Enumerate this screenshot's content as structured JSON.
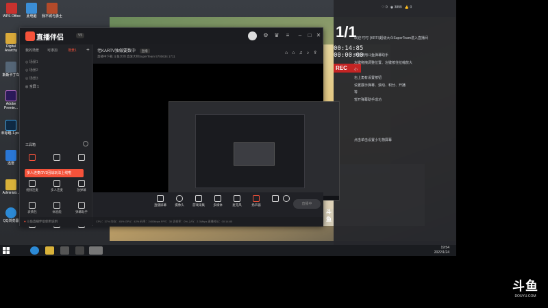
{
  "desktop": {
    "icons": [
      {
        "label": "WPS Office",
        "color": "#c8322e",
        "name": "wps-office-icon"
      },
      {
        "label": "此电脑",
        "color": "#3b8ed6",
        "name": "computer-icon"
      },
      {
        "label": "我不城与勇士",
        "color": "#b34a2a",
        "name": "game-icon"
      },
      {
        "label": "Digital Anarchy",
        "color": "#d9a93a",
        "name": "digital-anarchy-icon"
      },
      {
        "label": "斯斯卡丁车",
        "color": "#556677",
        "name": "kart-icon"
      },
      {
        "label": "Adobe Premie...",
        "color": "#2b1a5a",
        "name": "premiere-icon"
      },
      {
        "label": "未标题-1.psd",
        "color": "#0f2a44",
        "name": "psd-icon"
      },
      {
        "label": "迅雷",
        "color": "#2a77d6",
        "name": "xunlei-icon"
      },
      {
        "label": "Administr...",
        "color": "#d9b23a",
        "name": "folder-icon"
      },
      {
        "label": "QQ浏览器",
        "color": "#2c8ad6",
        "name": "qq-browser-icon"
      }
    ]
  },
  "chat": {
    "big_count": "1/1",
    "timestamp": "00:14:85\n00:00:00",
    "rec_label": "REC",
    "welcome": "欢迎 叮叮 {KRTI}超级大众SuperTeam进入直播间",
    "lines": [
      "欢迎使用斗鱼弹幕助手",
      "左键拖拽调整位置、左键按住拉缩放大",
      "小",
      "右上角有设置按钮",
      "设置展示弹幕、滚动、积分、开播",
      "等",
      "暂开弹幕助手成功"
    ],
    "setting_hint": "点击单击设置小礼物屏幕",
    "top_counts": [
      "0",
      "3899",
      "0"
    ]
  },
  "window": {
    "brand": "直播伴侣",
    "version": "V5",
    "tabs": [
      "我的场景",
      "可添加",
      "场景1"
    ],
    "scenes": [
      "场景1",
      "场景2",
      "场景3",
      "全屏 1"
    ],
    "toolbox_label": "工具箱",
    "tools": [
      "直播游戏",
      "多人连麦",
      "直播日志",
      "视频连麦",
      "多人连麦",
      "放弹幕",
      "表情包",
      "体验能",
      "弹幕助手",
      "上瞬间",
      "关心"
    ],
    "promo": "多人连麦/3V3团战玩法上线啦",
    "notice": "斗鱼直播伴侣使用说明",
    "room_title": "老KARTV独做要数中",
    "room_status": "直播",
    "room_sub": "直播中下载   斗鱼大师  直发大师SuperTeam    5700634    1711",
    "bottom_buttons": [
      "直播屏幕",
      "摄像头",
      "游戏采集",
      "多媒体",
      "麦克风",
      "扬声器"
    ],
    "golive_label": "直播中",
    "status_text": "CPU：37%   内存：45%   GPU：42%   码率：2400kbps   FPS：30   丢帧率：0%   上行：2.3Mbps   直播时长：00:14:85"
  },
  "taskbar": {
    "time": "19:54",
    "date": "2022/1/24"
  },
  "watermark": {
    "brand": "斗鱼",
    "url": "DOUYU.COM"
  }
}
